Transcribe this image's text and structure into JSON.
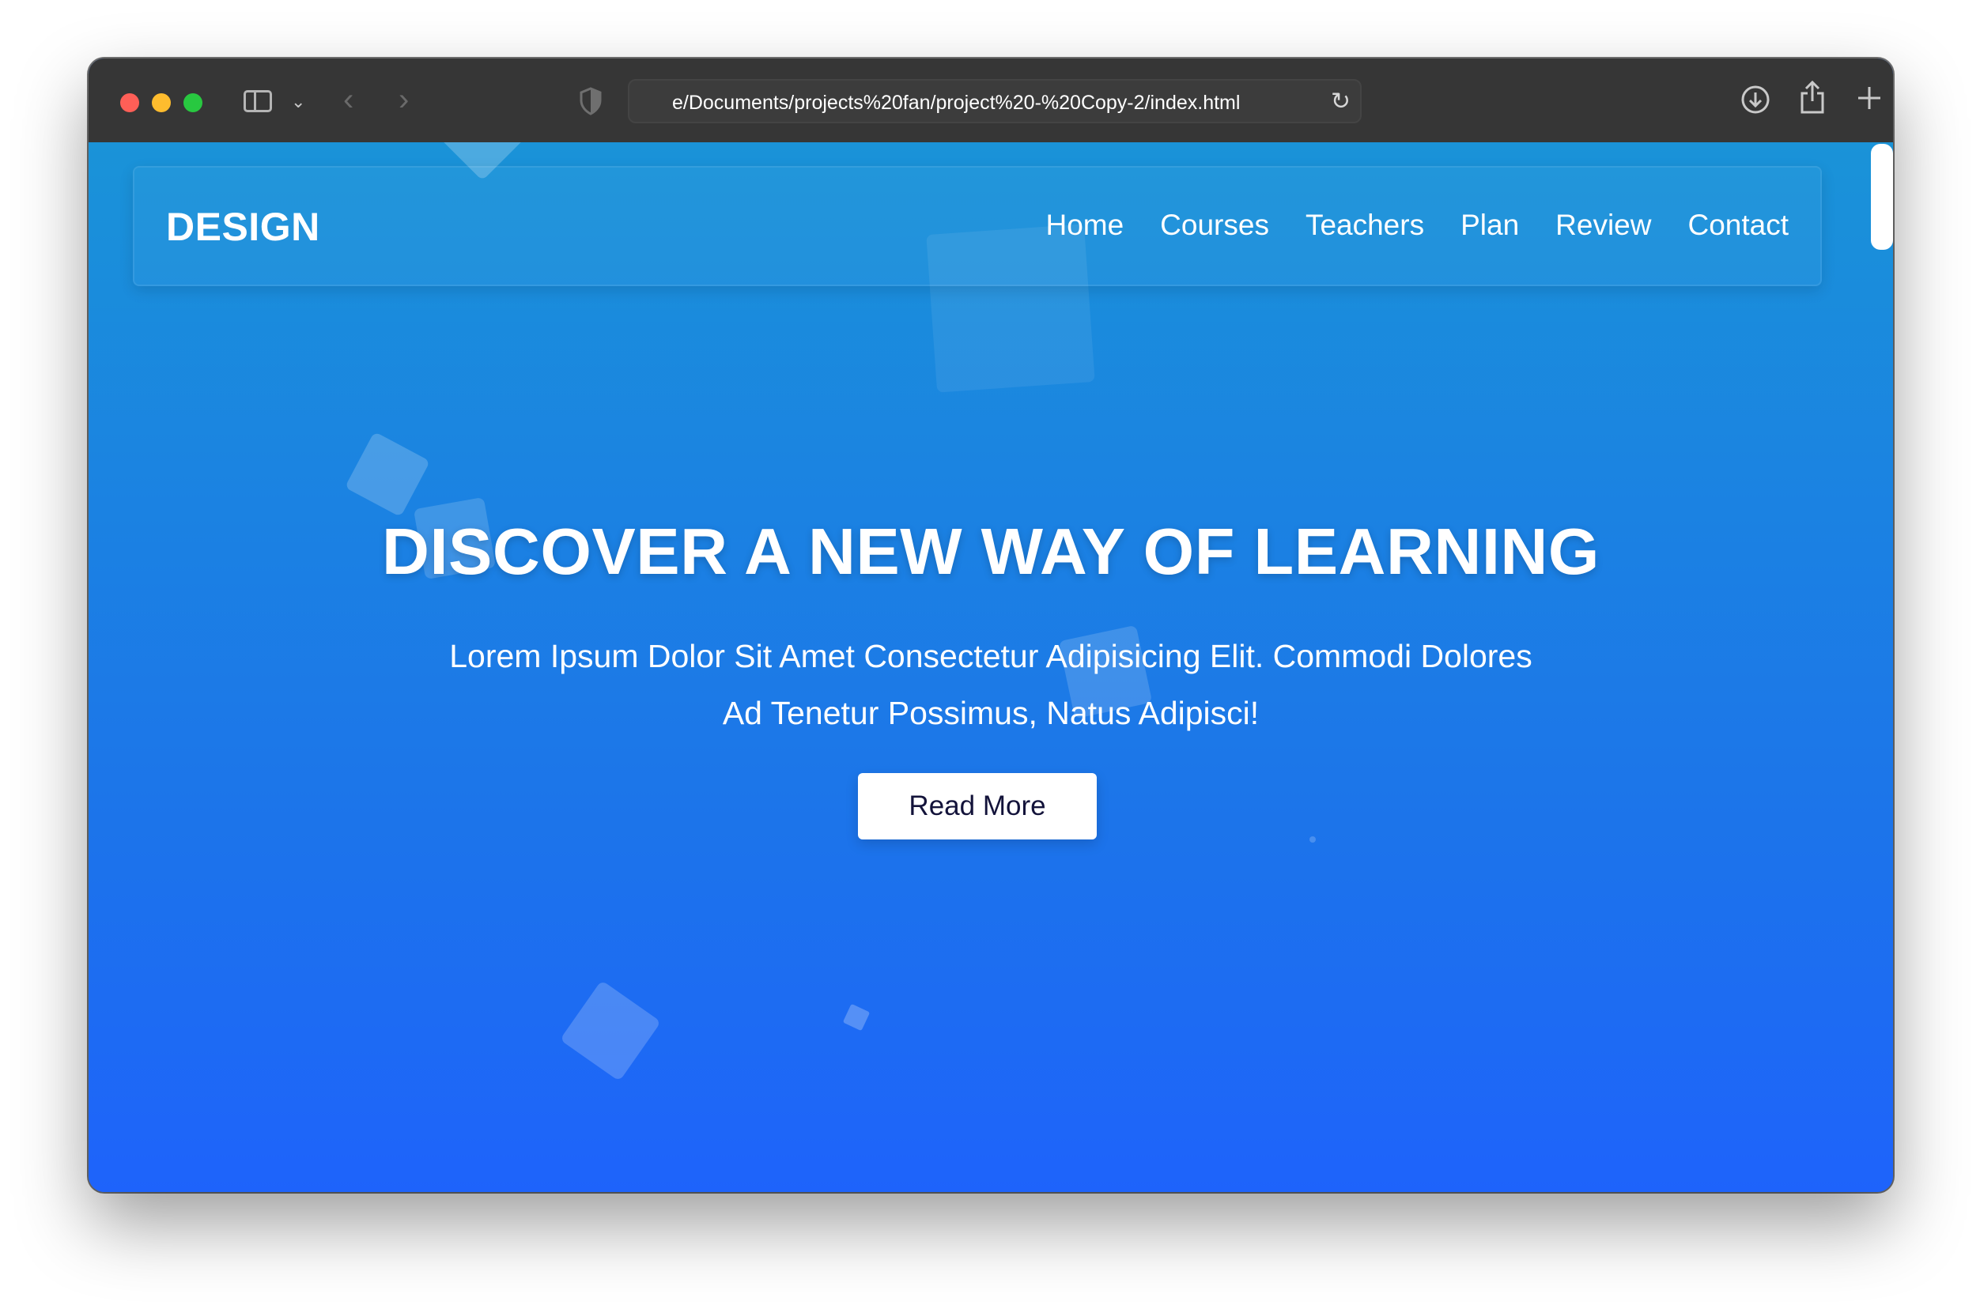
{
  "browser": {
    "url": "e/Documents/projects%20fan/project%20-%20Copy-2/index.html",
    "icons": {
      "sidebar": "sidebar-icon",
      "chevron": "chevron-down-icon",
      "back": "back-arrow-icon",
      "forward": "forward-arrow-icon",
      "privacy": "shield-icon",
      "reload": "reload-icon",
      "download": "download-icon",
      "share": "share-icon",
      "new_tab": "plus-icon",
      "tab_overview": "grid-icon"
    },
    "glyphs": {
      "chevron": "⌄",
      "back": "‹",
      "forward": "›",
      "reload": "↻"
    }
  },
  "navbar": {
    "logo": "DESIGN",
    "links": [
      "Home",
      "Courses",
      "Teachers",
      "Plan",
      "Review",
      "Contact"
    ]
  },
  "hero": {
    "title": "DISCOVER A NEW WAY OF LEARNING",
    "text_line1": "Lorem Ipsum Dolor Sit Amet Consectetur Adipisicing Elit. Commodi Dolores",
    "text_line2": "Ad Tenetur Possimus, Natus Adipisci!",
    "button": "Read More"
  },
  "colors": {
    "gradient_top": "#1a93d8",
    "gradient_bottom": "#1e63fb",
    "toolbar": "#363636",
    "button_text": "#13133a"
  }
}
